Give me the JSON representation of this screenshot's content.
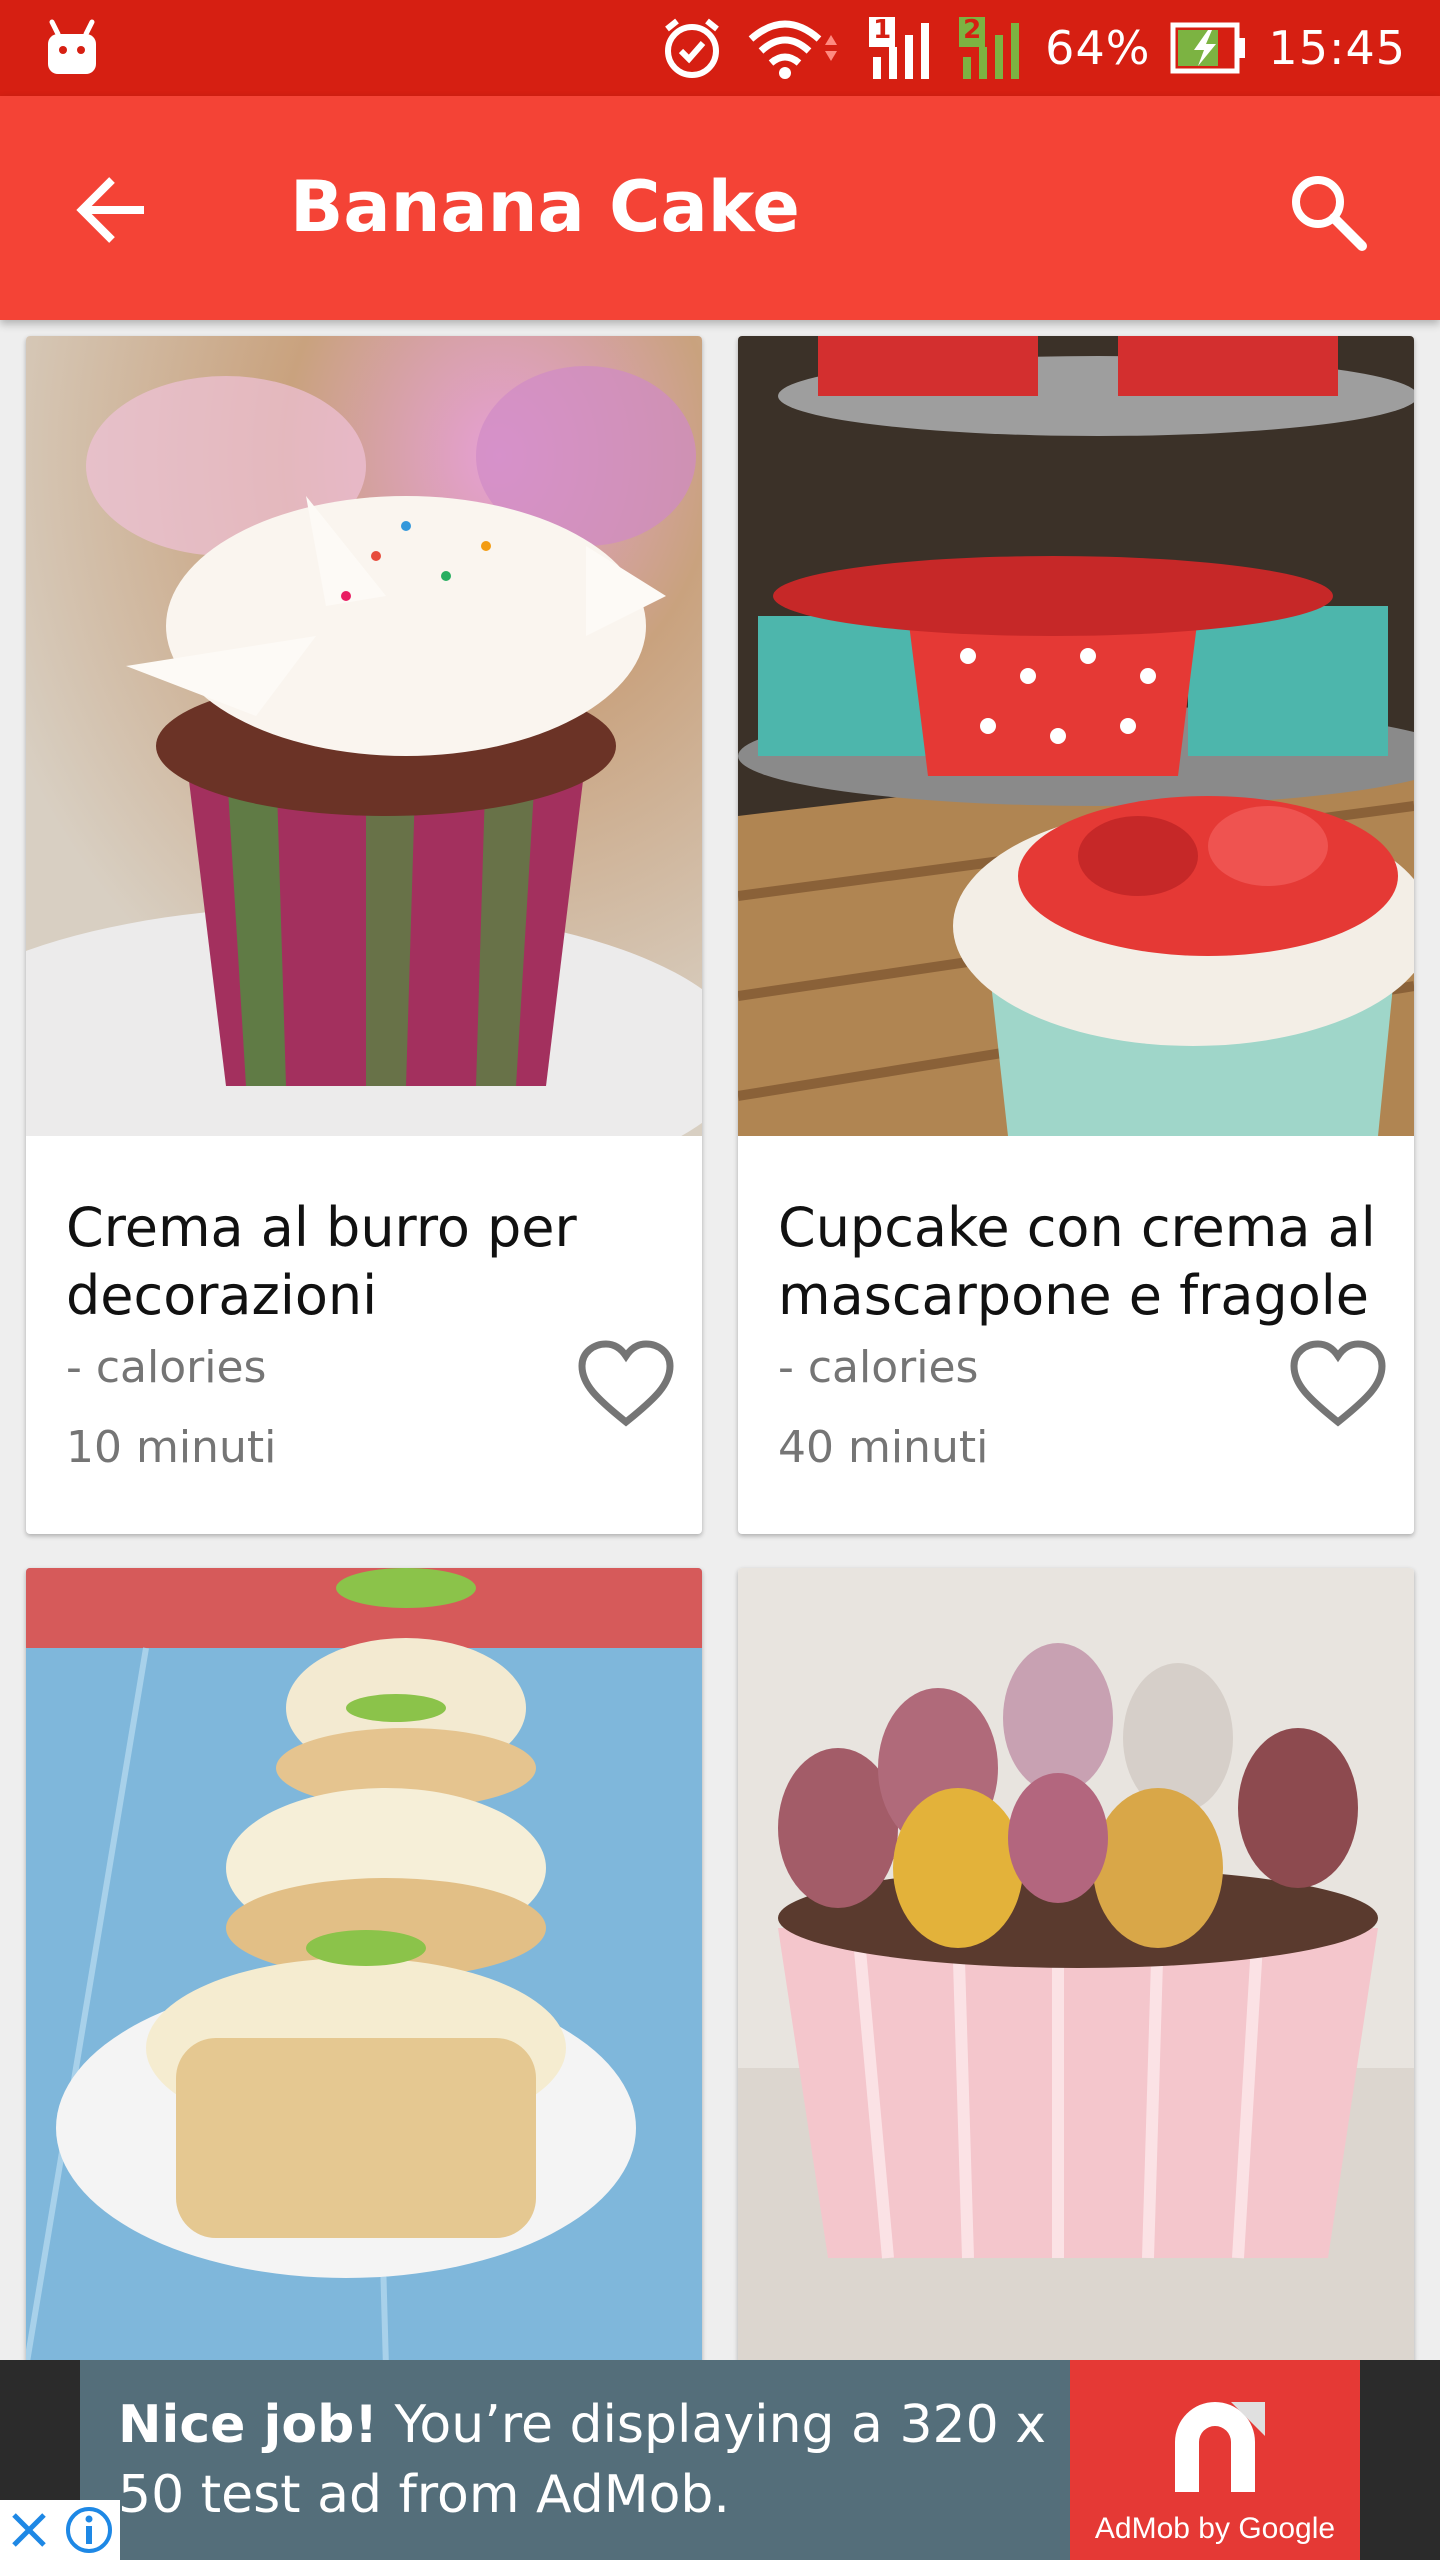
{
  "status_bar": {
    "battery": "64%",
    "time": "15:45",
    "sim1_label": "1",
    "sim2_label": "2",
    "icons": [
      "android-icon",
      "alarm-icon",
      "wifi-icon",
      "signal-icon",
      "battery-charging-icon"
    ]
  },
  "app_bar": {
    "title": "Banana Cake",
    "back_icon": "arrow-back-icon",
    "search_icon": "search-icon",
    "color": "#f44336"
  },
  "recipes": [
    {
      "title": "Crema al burro per decorazioni",
      "calories": "- calories",
      "time": "10 minuti",
      "favorite": false
    },
    {
      "title": "Cupcake con crema al mascarpone e fragole",
      "calories": "- calories",
      "time": "40 minuti",
      "favorite": false
    },
    {
      "title": "",
      "calories": "",
      "time": "",
      "favorite": false
    },
    {
      "title": "",
      "calories": "",
      "time": "",
      "favorite": false
    }
  ],
  "ad": {
    "headline": "Nice job!",
    "body": " You’re displaying a 320 x 50 test ad from AdMob.",
    "brand": "AdMob by Google",
    "close_icon": "close-icon",
    "info_icon": "info-icon"
  }
}
